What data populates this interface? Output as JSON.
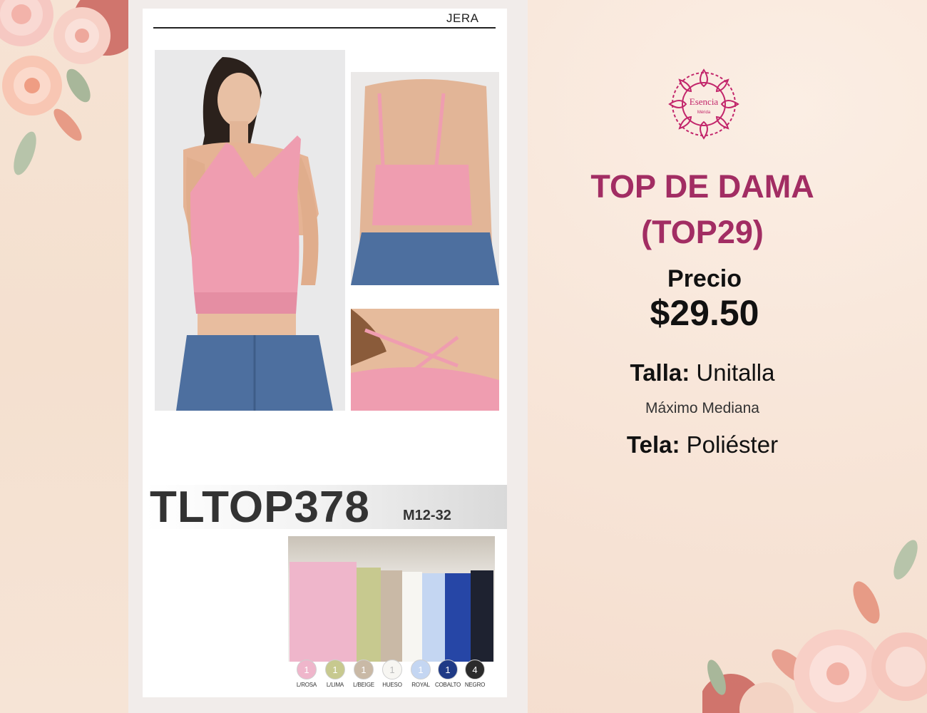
{
  "sheet": {
    "brand": "JERA",
    "code": "TLTOP378",
    "code_sub": "M12-32",
    "colors": [
      {
        "count": "1",
        "label": "L/ROSA",
        "hex": "#efb6cb",
        "text": "#ffffff"
      },
      {
        "count": "1",
        "label": "L/LIMA",
        "hex": "#c7c98f",
        "text": "#ffffff"
      },
      {
        "count": "1",
        "label": "L/BEIGE",
        "hex": "#c9b9a6",
        "text": "#ffffff"
      },
      {
        "count": "1",
        "label": "HUESO",
        "hex": "#f7f6f2",
        "text": "#bbbbbb"
      },
      {
        "count": "1",
        "label": "ROYAL",
        "hex": "#c4d6f2",
        "text": "#ffffff"
      },
      {
        "count": "1",
        "label": "COBALTO",
        "hex": "#1f3a86",
        "text": "#ffffff"
      },
      {
        "count": "4",
        "label": "NEGRO",
        "hex": "#2b2b2b",
        "text": "#ffffff"
      }
    ]
  },
  "product": {
    "title": "TOP DE DAMA (TOP29)",
    "price_label": "Precio",
    "price": "$29.50",
    "size_label": "Talla:",
    "size_value": "Unitalla",
    "size_note": "Máximo Mediana",
    "fabric_label": "Tela:",
    "fabric_value": "Poliéster"
  },
  "logo": {
    "line1": "Esencia",
    "line2": "Mérida",
    "color": "#c2266b"
  },
  "accent_colors": {
    "title": "#a22d63",
    "top_pink": "#ef9db0",
    "denim": "#4d6f9f"
  }
}
